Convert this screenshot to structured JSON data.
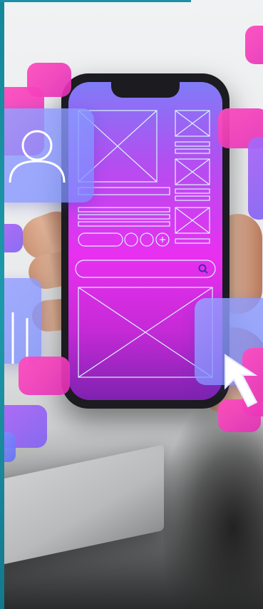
{
  "scene": {
    "description_free": true,
    "colors": {
      "accent_teal": "#1b8fa4",
      "phone_screen_top": "#7f7cf7",
      "phone_screen_mid": "#e92ff0",
      "card_blue": "#838cff",
      "card_pink": "#ff4dbf",
      "card_violet": "#ac66f7"
    },
    "icons": [
      "user-icon",
      "search-icon",
      "plus-circle-icon",
      "cursor-arrow-icon",
      "equalizer-icon"
    ]
  }
}
